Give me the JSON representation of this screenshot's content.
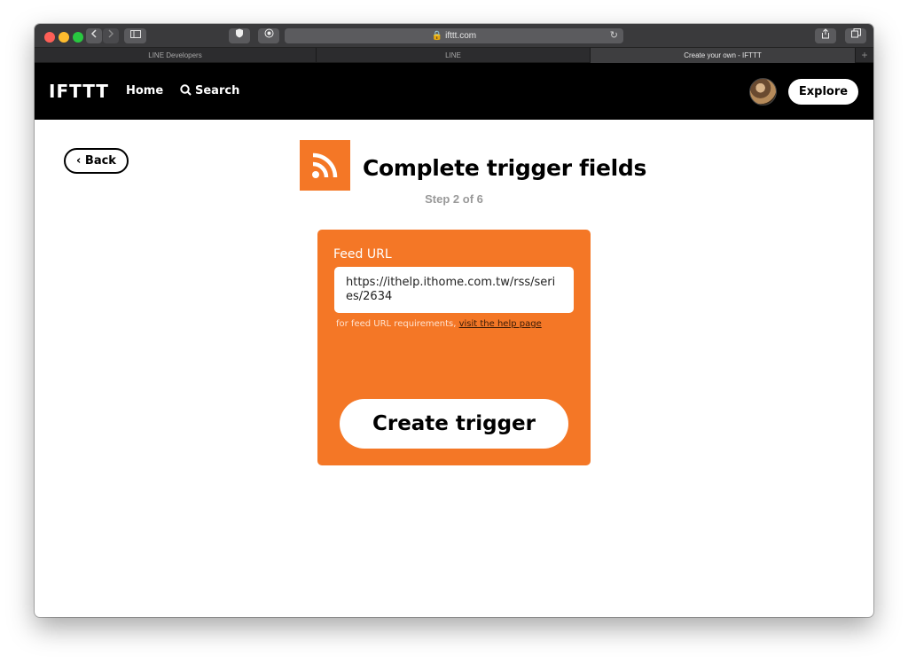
{
  "browser": {
    "address": "ifttt.com",
    "tabs": [
      {
        "label": "LINE Developers"
      },
      {
        "label": "LINE"
      },
      {
        "label": "Create your own - IFTTT"
      }
    ]
  },
  "header": {
    "logo": "IFTTT",
    "home": "Home",
    "search": "Search",
    "explore": "Explore"
  },
  "page": {
    "back": "Back",
    "title": "Complete trigger fields",
    "step": "Step 2 of 6",
    "service_icon": "rss-icon",
    "accent": "#f47726"
  },
  "form": {
    "label": "Feed URL",
    "value": "https://ithelp.ithome.com.tw/rss/series/2634",
    "help_text": "for feed URL requirements, ",
    "help_link": "visit the help page",
    "submit": "Create trigger"
  }
}
